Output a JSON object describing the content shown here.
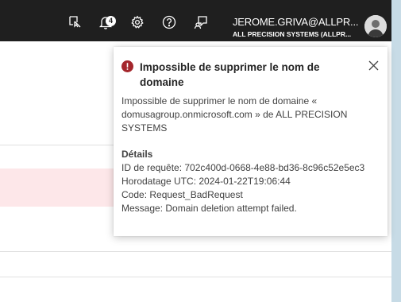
{
  "header": {
    "notification_count": "4",
    "icons": [
      "feedback-icon",
      "bell-icon",
      "gear-icon",
      "help-icon",
      "chat-icon"
    ],
    "account_name": "JEROME.GRIVA@ALLPR...",
    "account_org": "ALL PRECISION SYSTEMS (ALLPR..."
  },
  "toast": {
    "title": "Impossible de supprimer le nom de domaine",
    "message": "Impossible de supprimer le nom de domaine « domusagroup.onmicrosoft.com » de ALL PRECISION SYSTEMS",
    "details_heading": "Détails",
    "request_id": "ID de requête: 702c400d-0668-4e88-bd36-8c96c52e5ec3",
    "timestamp": "Horodatage UTC: 2024-01-22T19:06:44",
    "code": "Code: Request_BadRequest",
    "error_message": "Message: Domain deletion attempt failed."
  },
  "colors": {
    "topbar": "#1f1f1f",
    "error": "#a4262c",
    "highlight_row": "#fde7e9"
  }
}
